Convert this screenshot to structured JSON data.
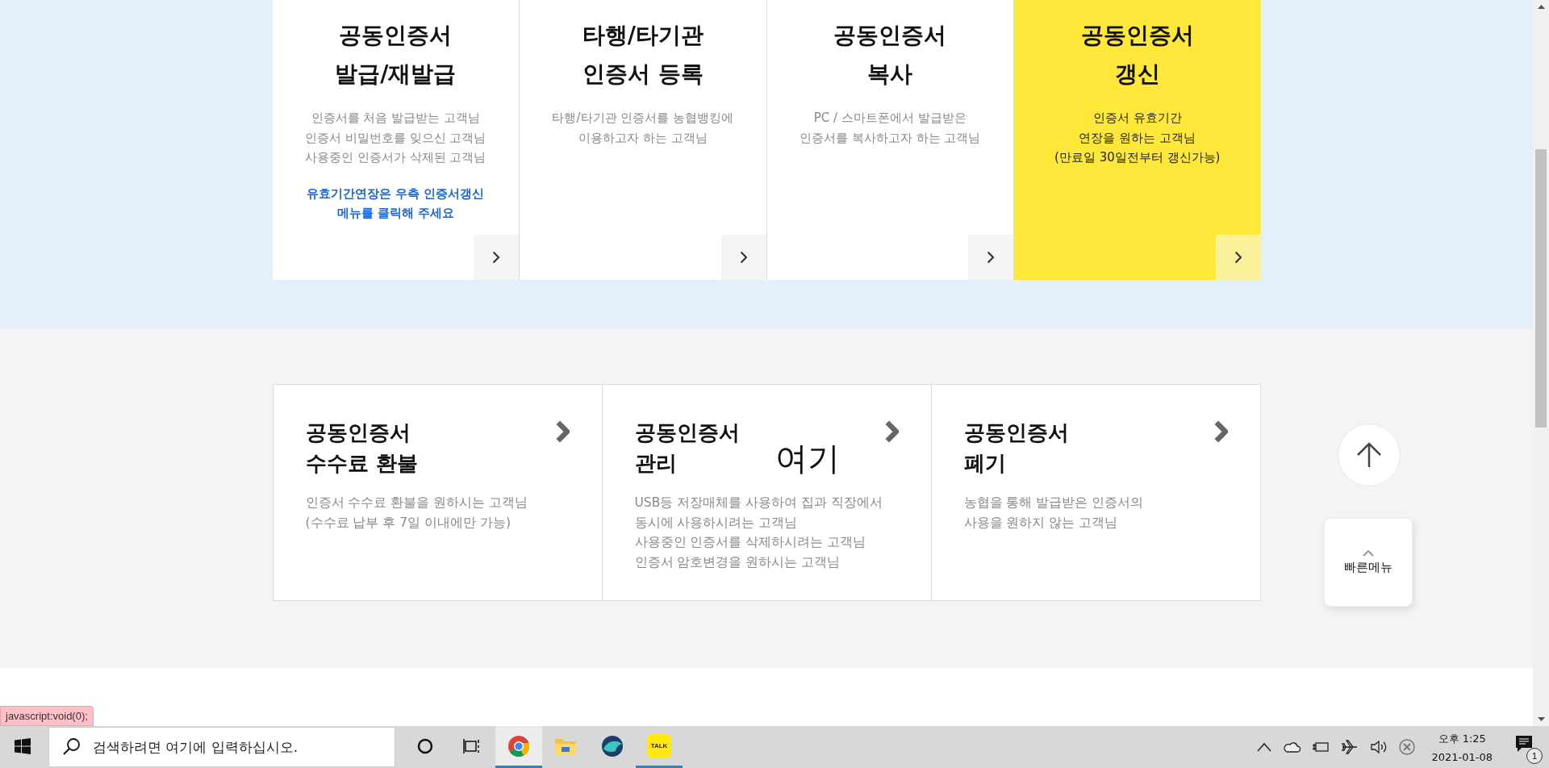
{
  "top_cards": [
    {
      "title_lines": [
        "공동인증서",
        "발급/재발급"
      ],
      "description_lines": [
        "인증서를 처음 발급받는 고객님",
        "인증서 비밀번호를 잊으신 고객님",
        "사용중인 인증서가 삭제된 고객님"
      ],
      "notice_lines": [
        "유효기간연장은 우측 인증서갱신",
        "메뉴를 클릭해 주세요"
      ],
      "highlighted": false
    },
    {
      "title_lines": [
        "타행/타기관",
        "인증서 등록"
      ],
      "description_lines": [
        "타행/타기관 인증서를 농협뱅킹에",
        "이용하고자 하는 고객님"
      ],
      "highlighted": false
    },
    {
      "title_lines": [
        "공동인증서",
        "복사"
      ],
      "description_lines": [
        "PC / 스마트폰에서 발급받은",
        "인증서를 복사하고자 하는 고객님"
      ],
      "highlighted": false
    },
    {
      "title_lines": [
        "공동인증서",
        "갱신"
      ],
      "description_lines": [
        "인증서 유효기간",
        "연장을 원하는 고객님",
        "(만료일 30일전부터 갱신가능)"
      ],
      "highlighted": true
    }
  ],
  "bottom_cards": [
    {
      "title_lines": [
        "공동인증서",
        "수수료 환불"
      ],
      "description_lines": [
        "인증서 수수료 환불을 원하시는 고객님",
        "(수수료 납부 후 7일 이내에만 가능)"
      ]
    },
    {
      "title_lines": [
        "공동인증서",
        "관리"
      ],
      "description_lines": [
        "USB등 저장매체를 사용하여 집과 직장에서",
        "동시에 사용하시려는 고객님",
        "사용중인 인증서를 삭제하시려는 고객님",
        "인증서 암호변경을 원하시는 고객님"
      ],
      "annotation": "여기"
    },
    {
      "title_lines": [
        "공동인증서",
        "폐기"
      ],
      "description_lines": [
        "농협을 통해 발급받은 인증서의",
        "사용을 원하지 않는 고객님"
      ]
    }
  ],
  "quick_menu": {
    "label": "빠른메뉴"
  },
  "status_link": "javascript:void(0);",
  "taskbar": {
    "search": {
      "placeholder": "검색하려면 여기에 입력하십시오."
    },
    "apps": [
      {
        "kind": "chrome",
        "selected": true,
        "running": true
      },
      {
        "kind": "explorer",
        "selected": false,
        "running": false
      },
      {
        "kind": "whale",
        "selected": false,
        "running": false
      },
      {
        "kind": "kakao",
        "label": "TALK",
        "selected": false,
        "running": true
      }
    ],
    "clock": {
      "time": "오후 1:25",
      "date": "2021-01-08"
    },
    "notifications": {
      "count": "1"
    }
  }
}
